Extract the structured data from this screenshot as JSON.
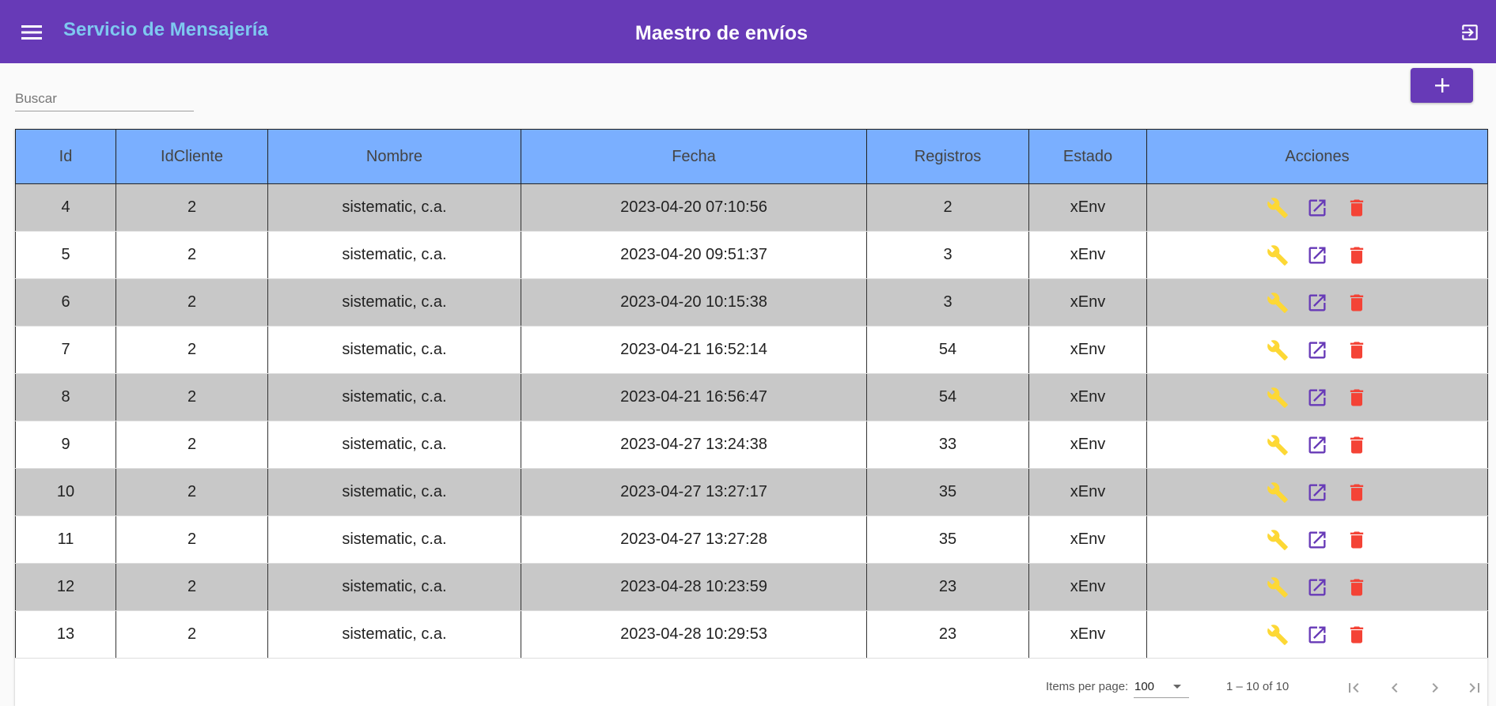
{
  "app": {
    "brand": "Servicio de Mensajería",
    "page_title": "Maestro de envíos",
    "colors": {
      "toolbar": "#673ab7",
      "brand_text": "#7ec8f0",
      "table_header": "#7aafff",
      "row_alt": "#c8c8c8",
      "wrench": "#fdd835",
      "open": "#673ab7",
      "delete": "#f44336"
    },
    "icons": {
      "menu": "menu-icon",
      "logout": "logout-icon",
      "add": "plus-icon",
      "edit": "wrench-icon",
      "open": "open-in-new-icon",
      "delete": "trash-icon"
    }
  },
  "search": {
    "placeholder": "Buscar",
    "value": ""
  },
  "table": {
    "columns": [
      "Id",
      "IdCliente",
      "Nombre",
      "Fecha",
      "Registros",
      "Estado",
      "Acciones"
    ],
    "rows": [
      {
        "id": "4",
        "cliente": "2",
        "nombre": "sistematic, c.a.",
        "fecha": "2023-04-20 07:10:56",
        "registros": "2",
        "estado": "xEnv"
      },
      {
        "id": "5",
        "cliente": "2",
        "nombre": "sistematic, c.a.",
        "fecha": "2023-04-20 09:51:37",
        "registros": "3",
        "estado": "xEnv"
      },
      {
        "id": "6",
        "cliente": "2",
        "nombre": "sistematic, c.a.",
        "fecha": "2023-04-20 10:15:38",
        "registros": "3",
        "estado": "xEnv"
      },
      {
        "id": "7",
        "cliente": "2",
        "nombre": "sistematic, c.a.",
        "fecha": "2023-04-21 16:52:14",
        "registros": "54",
        "estado": "xEnv"
      },
      {
        "id": "8",
        "cliente": "2",
        "nombre": "sistematic, c.a.",
        "fecha": "2023-04-21 16:56:47",
        "registros": "54",
        "estado": "xEnv"
      },
      {
        "id": "9",
        "cliente": "2",
        "nombre": "sistematic, c.a.",
        "fecha": "2023-04-27 13:24:38",
        "registros": "33",
        "estado": "xEnv"
      },
      {
        "id": "10",
        "cliente": "2",
        "nombre": "sistematic, c.a.",
        "fecha": "2023-04-27 13:27:17",
        "registros": "35",
        "estado": "xEnv"
      },
      {
        "id": "11",
        "cliente": "2",
        "nombre": "sistematic, c.a.",
        "fecha": "2023-04-27 13:27:28",
        "registros": "35",
        "estado": "xEnv"
      },
      {
        "id": "12",
        "cliente": "2",
        "nombre": "sistematic, c.a.",
        "fecha": "2023-04-28 10:23:59",
        "registros": "23",
        "estado": "xEnv"
      },
      {
        "id": "13",
        "cliente": "2",
        "nombre": "sistematic, c.a.",
        "fecha": "2023-04-28 10:29:53",
        "registros": "23",
        "estado": "xEnv"
      }
    ]
  },
  "paginator": {
    "items_label": "Items per page:",
    "page_size": "100",
    "range": "1 – 10 of 10"
  }
}
